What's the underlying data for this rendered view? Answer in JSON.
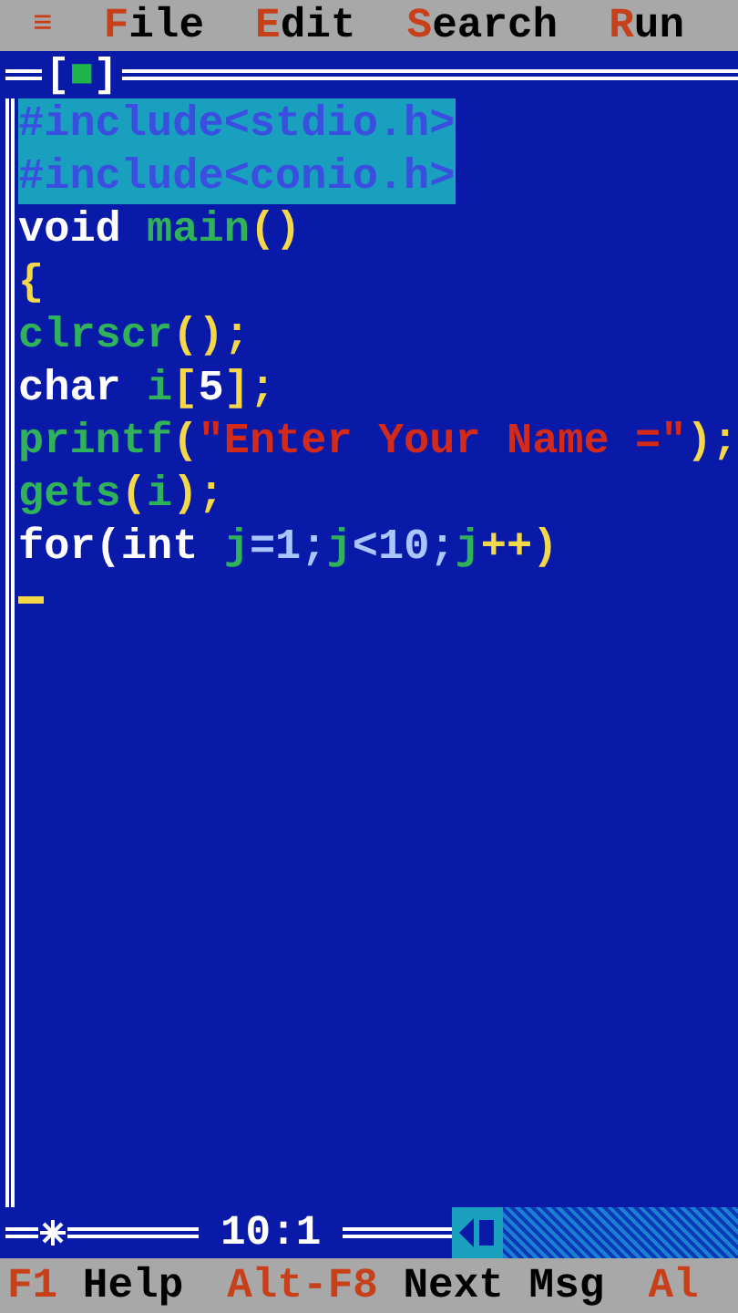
{
  "menu_bar": {
    "items": [
      {
        "kind": "system",
        "hotkey": "≡"
      },
      {
        "kind": "menu",
        "hotkey": "F",
        "rest": "ile"
      },
      {
        "kind": "menu",
        "hotkey": "E",
        "rest": "dit"
      },
      {
        "kind": "menu",
        "hotkey": "S",
        "rest": "earch"
      },
      {
        "kind": "menu",
        "hotkey": "R",
        "rest": "un"
      }
    ]
  },
  "editor": {
    "close_box": "[■]",
    "lines": [
      {
        "selected": true,
        "tokens": [
          {
            "kind": "directive",
            "text": "#include<stdio.h>"
          }
        ]
      },
      {
        "selected": true,
        "tokens": [
          {
            "kind": "directive",
            "text": "#include<conio.h>"
          }
        ]
      },
      {
        "selected": false,
        "tokens": [
          {
            "kind": "keyword",
            "text": "void "
          },
          {
            "kind": "ident",
            "text": "main"
          },
          {
            "kind": "symbol",
            "text": "()"
          }
        ]
      },
      {
        "selected": false,
        "tokens": [
          {
            "kind": "symbol",
            "text": "{"
          }
        ]
      },
      {
        "selected": false,
        "tokens": [
          {
            "kind": "ident",
            "text": "clrscr"
          },
          {
            "kind": "symbol",
            "text": "();"
          }
        ]
      },
      {
        "selected": false,
        "tokens": [
          {
            "kind": "keyword",
            "text": "char "
          },
          {
            "kind": "ident",
            "text": "i"
          },
          {
            "kind": "symbol",
            "text": "["
          },
          {
            "kind": "keyword",
            "text": "5"
          },
          {
            "kind": "symbol",
            "text": "];"
          }
        ]
      },
      {
        "selected": false,
        "tokens": [
          {
            "kind": "ident",
            "text": "printf"
          },
          {
            "kind": "symbol",
            "text": "("
          },
          {
            "kind": "string",
            "text": "\"Enter Your Name =\""
          },
          {
            "kind": "symbol",
            "text": ");"
          }
        ]
      },
      {
        "selected": false,
        "tokens": [
          {
            "kind": "ident",
            "text": "gets"
          },
          {
            "kind": "symbol",
            "text": "("
          },
          {
            "kind": "ident",
            "text": "i"
          },
          {
            "kind": "symbol",
            "text": ");"
          }
        ]
      },
      {
        "selected": false,
        "tokens": [
          {
            "kind": "keyword",
            "text": "for(int "
          },
          {
            "kind": "ident",
            "text": "j"
          },
          {
            "kind": "number",
            "text": "=1;"
          },
          {
            "kind": "ident",
            "text": "j"
          },
          {
            "kind": "number",
            "text": "<10;"
          },
          {
            "kind": "ident",
            "text": "j"
          },
          {
            "kind": "symbol",
            "text": "++)"
          }
        ]
      }
    ],
    "position": "10:1"
  },
  "status_bar": {
    "items": [
      {
        "key": "F1",
        "label": "Help"
      },
      {
        "key": "Alt-F8",
        "label": "Next Msg"
      },
      {
        "key": "Al"
      }
    ]
  }
}
